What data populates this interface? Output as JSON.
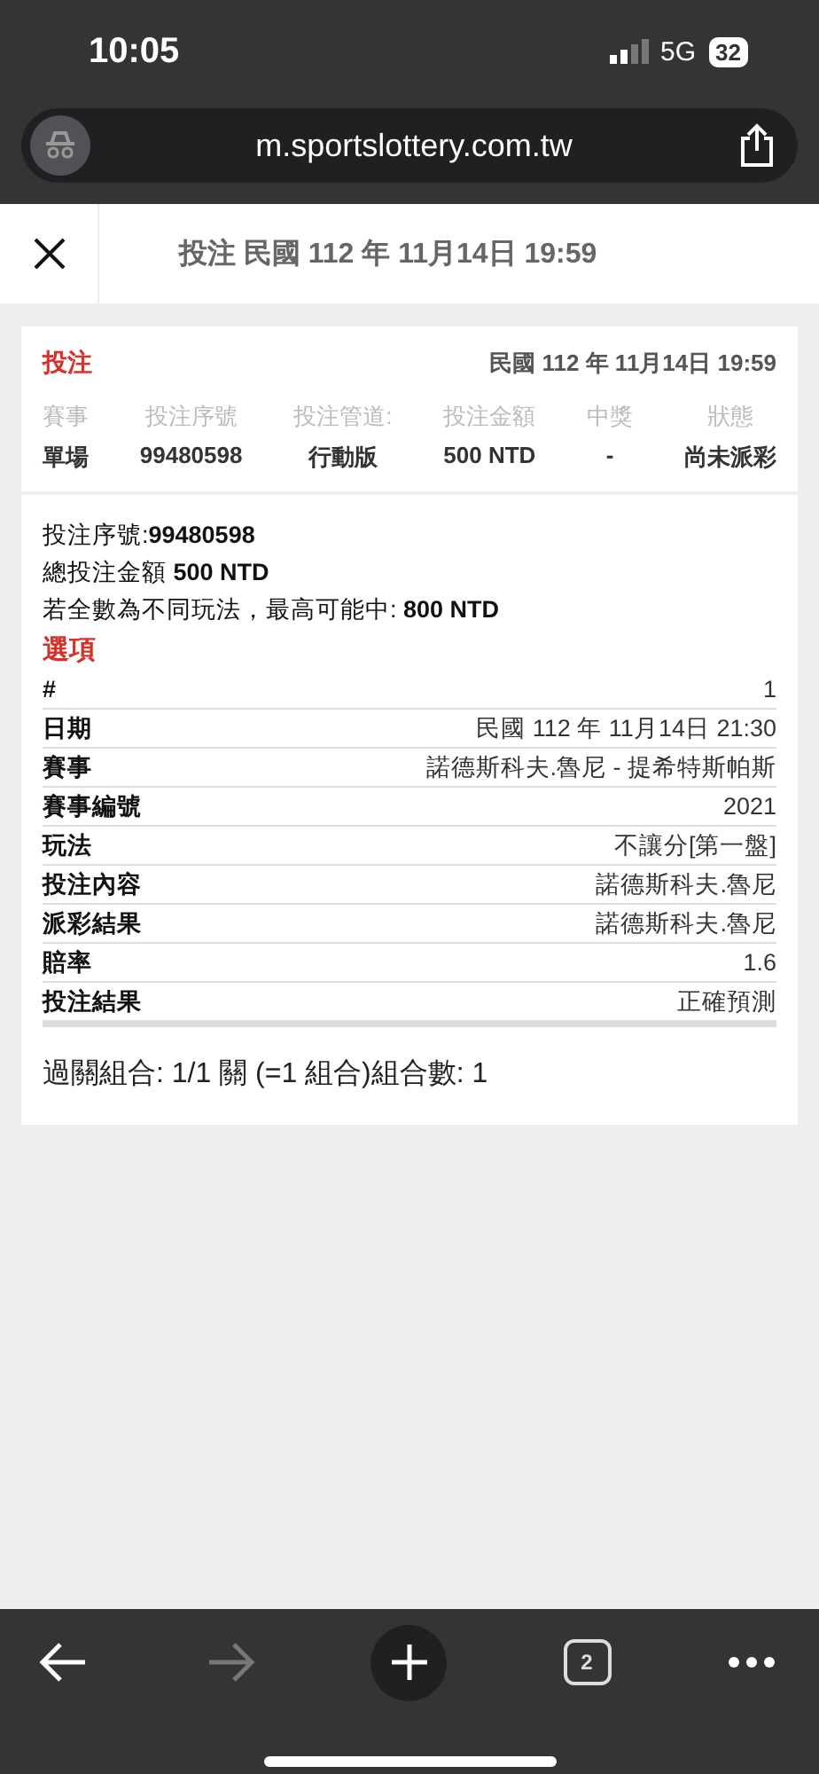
{
  "status_bar": {
    "time": "10:05",
    "network": "5G",
    "battery": "32"
  },
  "address_bar": {
    "url": "m.sportslottery.com.tw"
  },
  "header": {
    "title": "投注 民國 112 年 11月14日 19:59"
  },
  "summary": {
    "label": "投注",
    "date": "民國 112 年 11月14日 19:59",
    "columns": [
      {
        "header": "賽事",
        "value": "單場"
      },
      {
        "header": "投注序號",
        "value": "99480598"
      },
      {
        "header": "投注管道:",
        "value": "行動版"
      },
      {
        "header": "投注金額",
        "value": "500 NTD"
      },
      {
        "header": "中獎",
        "value": "-"
      },
      {
        "header": "狀態",
        "value": "尚未派彩"
      }
    ]
  },
  "detail": {
    "lines": [
      "投注序號:**99480598**",
      "總投注金額 **500 NTD**",
      "若全數為不同玩法，最高可能中: **800 NTD**"
    ],
    "section_title": "選項",
    "rows": [
      {
        "label": "#",
        "value": "1"
      },
      {
        "label": "日期",
        "value": "民國 112 年 11月14日 21:30"
      },
      {
        "label": "賽事",
        "value": "諾德斯科夫.魯尼 - 提希特斯帕斯"
      },
      {
        "label": "賽事編號",
        "value": "2021"
      },
      {
        "label": "玩法",
        "value": "不讓分[第一盤]"
      },
      {
        "label": "投注內容",
        "value": "諾德斯科夫.魯尼"
      },
      {
        "label": "派彩結果",
        "value": "諾德斯科夫.魯尼"
      },
      {
        "label": "賠率",
        "value": "1.6"
      },
      {
        "label": "投注結果",
        "value": "正確預測"
      }
    ],
    "combination": "過關組合: 1/1 關 (=1 組合)組合數: 1"
  },
  "toolbar": [
    {
      "kind": "back",
      "disabled": false
    },
    {
      "kind": "forward",
      "disabled": true
    },
    {
      "kind": "new-tab"
    },
    {
      "kind": "tabs",
      "count": "2"
    },
    {
      "kind": "more"
    }
  ]
}
